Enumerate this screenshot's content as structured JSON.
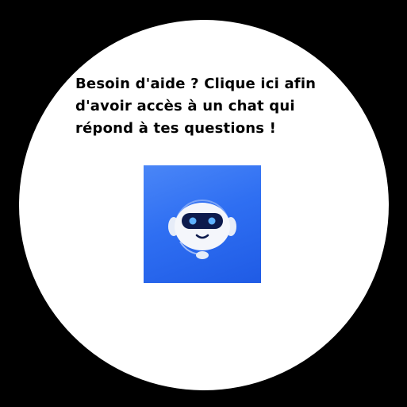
{
  "help_widget": {
    "lines": [
      "Besoin d'aide ? Clique ici afin",
      "d'avoir accès à un chat qui",
      "répond à tes questions !"
    ],
    "icon": "chatbot-robot-icon",
    "colors": {
      "background": "#000000",
      "circle": "#ffffff",
      "tile": "#2f6ff2",
      "robot_visor": "#0d1b4d",
      "robot_eyes": "#5fb2ff"
    }
  }
}
